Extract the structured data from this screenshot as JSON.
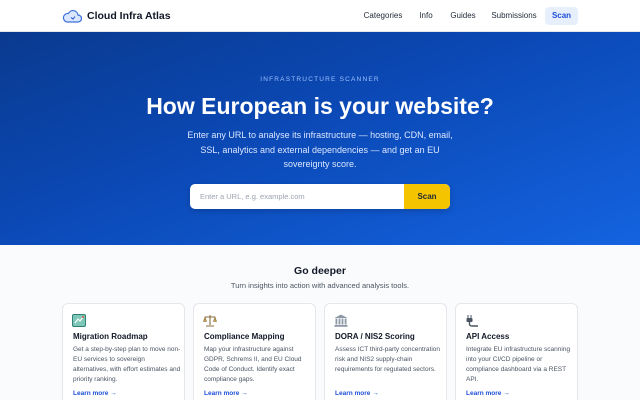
{
  "header": {
    "brand": "Cloud Infra Atlas",
    "nav": {
      "categories": "Categories",
      "info": "Info",
      "guides": "Guides",
      "submissions": "Submissions",
      "scan": "Scan"
    }
  },
  "hero": {
    "eyebrow": "INFRASTRUCTURE SCANNER",
    "title": "How European is your website?",
    "subtitle": "Enter any URL to analyse its infrastructure — hosting, CDN, email, SSL, analytics and external dependencies — and get an EU sovereignty score.",
    "search": {
      "placeholder": "Enter a URL, e.g. example.com",
      "value": "",
      "button": "Scan"
    }
  },
  "deeper": {
    "title": "Go deeper",
    "subtitle": "Turn insights into action with advanced analysis tools.",
    "cards": [
      {
        "icon": "map-icon",
        "title": "Migration Roadmap",
        "description": "Get a step-by-step plan to move non-EU services to sovereign alternatives, with effort estimates and priority ranking.",
        "link": "Learn more →"
      },
      {
        "icon": "scales-icon",
        "title": "Compliance Mapping",
        "description": "Map your infrastructure against GDPR, Schrems II, and EU Cloud Code of Conduct. Identify exact compliance gaps.",
        "link": "Learn more →"
      },
      {
        "icon": "bank-icon",
        "title": "DORA / NIS2 Scoring",
        "description": "Assess ICT third-party concentration risk and NIS2 supply-chain requirements for regulated sectors.",
        "link": "Learn more →"
      },
      {
        "icon": "plug-icon",
        "title": "API Access",
        "description": "Integrate EU infrastructure scanning into your CI/CD pipeline or compliance dashboard via a REST API.",
        "link": "Learn more →"
      }
    ]
  },
  "colors": {
    "accent": "#1d4ed8",
    "hero_start": "#0a3a8f",
    "hero_end": "#1463e0",
    "scan_button": "#f5c400"
  }
}
